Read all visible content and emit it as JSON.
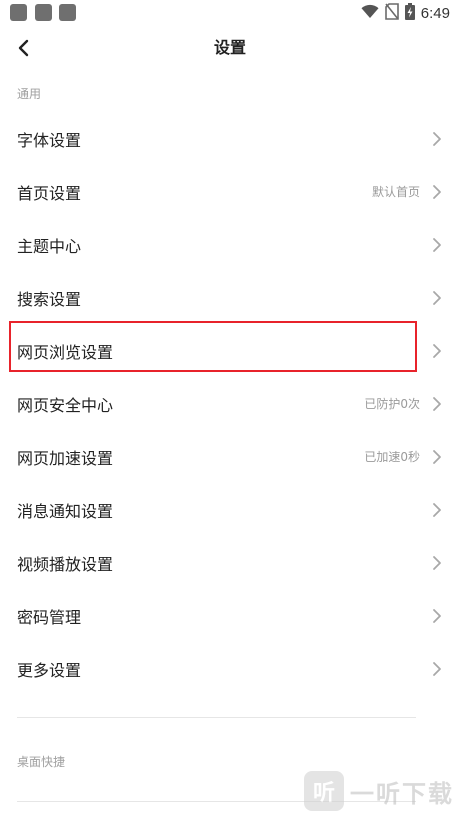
{
  "status_bar": {
    "time": "6:49",
    "notification_icons": [
      "notification-icon",
      "notification-icon",
      "notification-icon"
    ],
    "system_icons": [
      "wifi-icon",
      "no-sim-icon",
      "battery-charging-icon"
    ]
  },
  "header": {
    "title": "设置",
    "back_icon": "back-arrow-icon"
  },
  "sections": {
    "general": "通用",
    "desktop_shortcuts": "桌面快捷"
  },
  "settings": [
    {
      "label": "字体设置",
      "value": ""
    },
    {
      "label": "首页设置",
      "value": "默认首页"
    },
    {
      "label": "主题中心",
      "value": ""
    },
    {
      "label": "搜索设置",
      "value": ""
    },
    {
      "label": "网页浏览设置",
      "value": "",
      "highlighted": true
    },
    {
      "label": "网页安全中心",
      "value": "已防护0次"
    },
    {
      "label": "网页加速设置",
      "value": "已加速0秒"
    },
    {
      "label": "消息通知设置",
      "value": ""
    },
    {
      "label": "视频播放设置",
      "value": ""
    },
    {
      "label": "密码管理",
      "value": ""
    },
    {
      "label": "更多设置",
      "value": ""
    }
  ],
  "watermark": {
    "logo_char": "听",
    "text": "一听下载"
  },
  "colors": {
    "highlight": "#e8232b",
    "text_primary": "#222222",
    "text_secondary": "#9a9a9a",
    "section_header": "#a0a0a0",
    "divider": "#e6e6e6"
  }
}
